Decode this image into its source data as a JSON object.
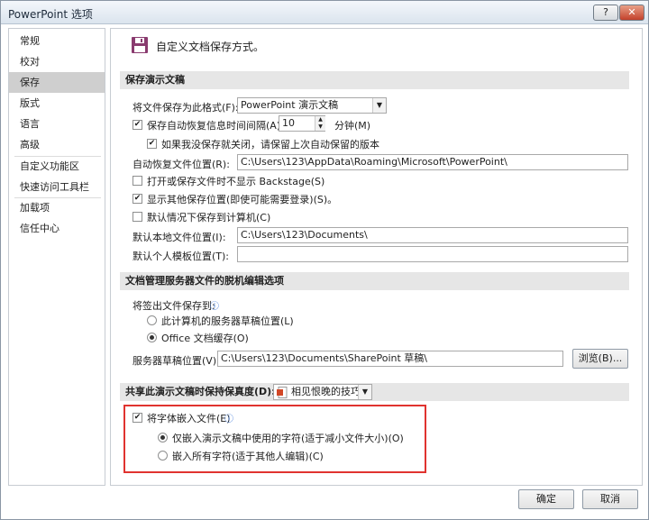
{
  "window": {
    "title": "PowerPoint 选项",
    "help_label": "?",
    "close_label": "✕"
  },
  "sidebar": {
    "items": [
      {
        "label": "常规"
      },
      {
        "label": "校对"
      },
      {
        "label": "保存"
      },
      {
        "label": "版式"
      },
      {
        "label": "语言"
      },
      {
        "label": "高级"
      },
      {
        "label": "自定义功能区"
      },
      {
        "label": "快速访问工具栏"
      },
      {
        "label": "加载项"
      },
      {
        "label": "信任中心"
      }
    ],
    "active": "保存"
  },
  "header": {
    "icon": "floppy-disk-icon",
    "text": "自定义文档保存方式。"
  },
  "save_section": {
    "title": "保存演示文稿",
    "format_label": "将文件保存为此格式(F):",
    "format_value": "PowerPoint 演示文稿",
    "autorecover_label": "保存自动恢复信息时间间隔(A)",
    "autorecover_checked": true,
    "autorecover_minutes": "10",
    "minutes_label": "分钟(M)",
    "keep_last_label": "如果我没保存就关闭，请保留上次自动保留的版本",
    "keep_last_checked": true,
    "recover_location_label": "自动恢复文件位置(R):",
    "recover_location_value": "C:\\Users\\123\\AppData\\Roaming\\Microsoft\\PowerPoint\\",
    "backstage_label": "打开或保存文件时不显示 Backstage(S)",
    "backstage_checked": false,
    "show_locations_label": "显示其他保存位置(即使可能需要登录)(S)。",
    "show_locations_checked": true,
    "save_to_computer_label": "默认情况下保存到计算机(C)",
    "save_to_computer_checked": false,
    "default_location_label": "默认本地文件位置(I):",
    "default_location_value": "C:\\Users\\123\\Documents\\",
    "template_location_label": "默认个人模板位置(T):",
    "template_location_value": ""
  },
  "offline_section": {
    "title": "文档管理服务器文件的脱机编辑选项",
    "checkout_label": "将签出文件保存到:",
    "option_server_label": "此计算机的服务器草稿位置(L)",
    "option_cache_label": "Office 文档缓存(O)",
    "selected": "cache",
    "drafts_label": "服务器草稿位置(V):",
    "drafts_value": "C:\\Users\\123\\Documents\\SharePoint 草稿\\",
    "browse_label": "浏览(B)..."
  },
  "fidelity_section": {
    "title": "共享此演示文稿时保持保真度(D):",
    "doc_icon": "powerpoint-document-icon",
    "doc_value": "相见恨晚的技巧",
    "embed_fonts_label": "将字体嵌入文件(E)",
    "embed_fonts_checked": true,
    "embed_only_used_label": "仅嵌入演示文稿中使用的字符(适于减小文件大小)(O)",
    "embed_all_label": "嵌入所有字符(适于其他人编辑)(C)",
    "embed_selected": "only_used"
  },
  "footer": {
    "ok_label": "确定",
    "cancel_label": "取消"
  },
  "colors": {
    "highlight_border": "#e0332f",
    "section_bg": "#e6e6e6",
    "nav_active": "#cfcfcf"
  }
}
